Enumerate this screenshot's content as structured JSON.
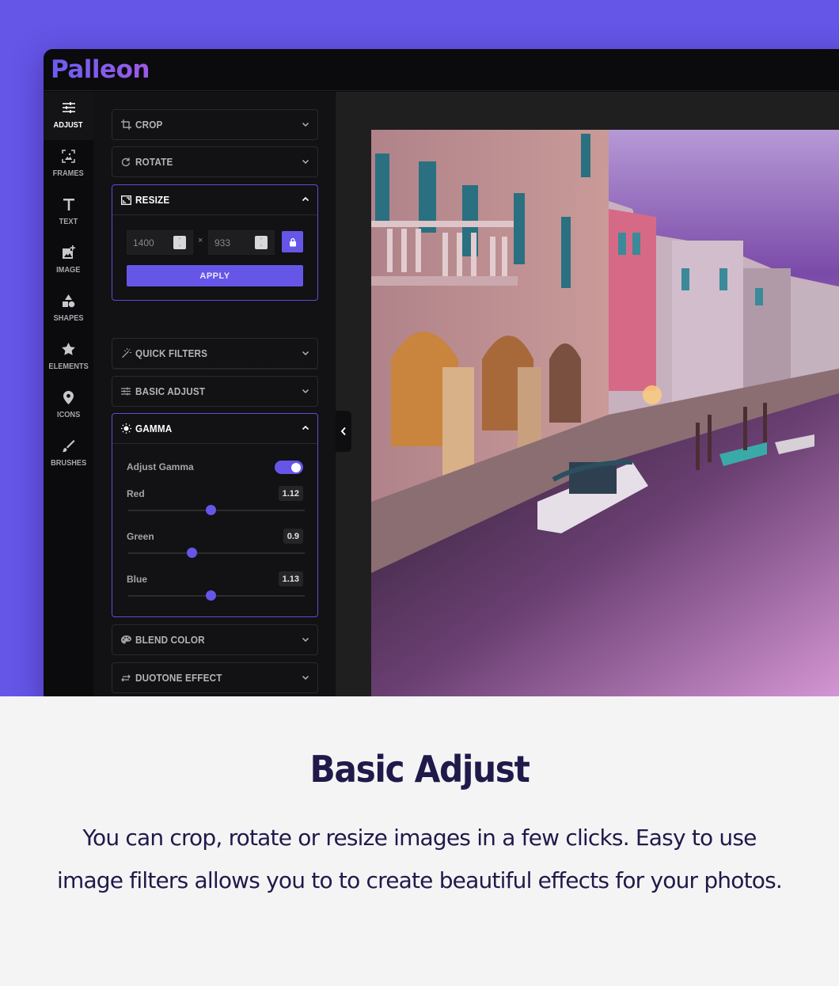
{
  "app": {
    "logo": "Palleon",
    "brand_color": "#6656e8",
    "background_color": "#6656e8"
  },
  "sidebar": {
    "items": [
      {
        "label": "ADJUST",
        "icon": "sliders-icon",
        "active": true
      },
      {
        "label": "FRAMES",
        "icon": "frame-icon",
        "active": false
      },
      {
        "label": "TEXT",
        "icon": "text-icon",
        "active": false
      },
      {
        "label": "IMAGE",
        "icon": "add-image-icon",
        "active": false
      },
      {
        "label": "SHAPES",
        "icon": "shapes-icon",
        "active": false
      },
      {
        "label": "ELEMENTS",
        "icon": "star-icon",
        "active": false
      },
      {
        "label": "ICONS",
        "icon": "map-pin-icon",
        "active": false
      },
      {
        "label": "BRUSHES",
        "icon": "brush-icon",
        "active": false
      }
    ]
  },
  "panel": {
    "crop": {
      "label": "CROP",
      "icon": "crop-icon",
      "expanded": false
    },
    "rotate": {
      "label": "ROTATE",
      "icon": "rotate-icon",
      "expanded": false
    },
    "resize": {
      "label": "RESIZE",
      "icon": "resize-icon",
      "expanded": true,
      "width": "1400",
      "height": "933",
      "separator": "×",
      "lock_icon": "lock-icon",
      "apply_label": "APPLY"
    },
    "quick_filters": {
      "label": "QUICK FILTERS",
      "icon": "magic-wand-icon",
      "expanded": false
    },
    "basic_adjust": {
      "label": "BASIC ADJUST",
      "icon": "sliders-icon",
      "expanded": false
    },
    "gamma": {
      "label": "GAMMA",
      "icon": "sun-icon",
      "expanded": true,
      "toggle_label": "Adjust Gamma",
      "toggle_on": true,
      "sliders": [
        {
          "label": "Red",
          "value": "1.12",
          "fraction": 0.47
        },
        {
          "label": "Green",
          "value": "0.9",
          "fraction": 0.36
        },
        {
          "label": "Blue",
          "value": "1.13",
          "fraction": 0.47
        }
      ]
    },
    "blend_color": {
      "label": "BLEND COLOR",
      "icon": "palette-icon",
      "expanded": false
    },
    "duotone": {
      "label": "DUOTONE EFFECT",
      "icon": "swap-icon",
      "expanded": false
    }
  },
  "canvas": {
    "collapse_icon": "chevron-left-icon",
    "image_description": "Venice canal at dusk with purple sky"
  },
  "footer": {
    "title": "Basic Adjust",
    "description": "You can crop, rotate or resize images in a few clicks. Easy to use image filters allows you to to create beautiful effects for your photos."
  }
}
